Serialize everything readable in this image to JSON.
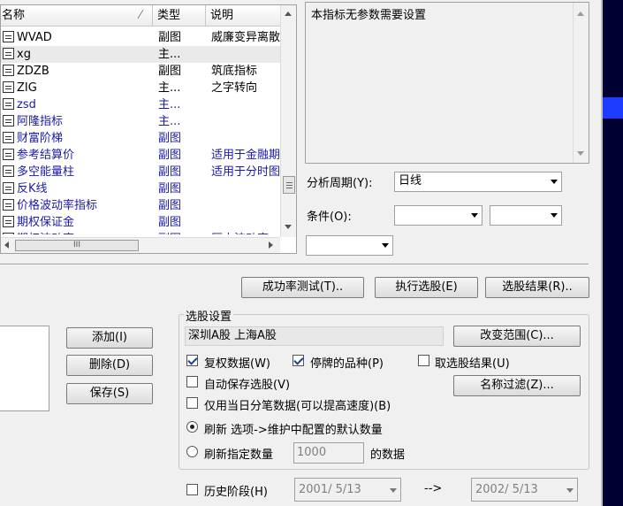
{
  "list": {
    "headers": [
      "名称",
      "类型",
      "说明"
    ],
    "rows": [
      {
        "name": "WVAD",
        "type": "副图",
        "desc": "威廉变异离散",
        "blue": false
      },
      {
        "name": "xg",
        "type": "主...",
        "desc": "",
        "blue": false
      },
      {
        "name": "ZDZB",
        "type": "副图",
        "desc": "筑底指标",
        "blue": false
      },
      {
        "name": "ZIG",
        "type": "主...",
        "desc": "之字转向",
        "blue": false
      },
      {
        "name": "zsd",
        "type": "主...",
        "desc": "",
        "blue": true
      },
      {
        "name": "阿隆指标",
        "type": "主...",
        "desc": "",
        "blue": true
      },
      {
        "name": "财富阶梯",
        "type": "副图",
        "desc": "",
        "blue": true
      },
      {
        "name": "参考结算价",
        "type": "副图",
        "desc": "适用于金融期货",
        "blue": true
      },
      {
        "name": "多空能量柱",
        "type": "副图",
        "desc": "适用于分时图",
        "blue": true
      },
      {
        "name": "反K线",
        "type": "副图",
        "desc": "",
        "blue": true
      },
      {
        "name": "价格波动率指标",
        "type": "副图",
        "desc": "",
        "blue": true
      },
      {
        "name": "期权保证金",
        "type": "副图",
        "desc": "",
        "blue": true
      },
      {
        "name": "期权波动率",
        "type": "副图",
        "desc": "历史波动率",
        "blue": true
      }
    ],
    "hscroll_thumb": "III"
  },
  "param_text": "本指标无参数需要设置",
  "period": {
    "label": "分析周期(Y):",
    "value": "日线"
  },
  "condition": {
    "label": "条件(O):",
    "value1": "",
    "value2": "",
    "value3": ""
  },
  "buttons": {
    "success_test": "成功率测试(T)..",
    "run_select": "执行选股(E)",
    "select_result": "选股结果(R).."
  },
  "side_buttons": {
    "add": "添加(I)",
    "delete": "删除(D)",
    "save": "保存(S)"
  },
  "settings": {
    "group_label": "选股设置",
    "range_text": "深圳A股  上海A股",
    "change_range": "改变范围(C)...",
    "fuquan": "复权数据(W)",
    "tingpai": "停牌的品种(P)",
    "take_result": "取选股结果(U)",
    "name_filter": "名称过滤(Z)...",
    "auto_save": "自动保存选股(V)",
    "today_only": "仅用当日分笔数据(可以提高速度)(B)",
    "refresh_default": "刷新 选项->维护中配置的默认数量",
    "refresh_count": "刷新指定数量",
    "count_value": "1000",
    "count_suffix": "的数据",
    "history": "历史阶段(H)",
    "date_from": "2001/ 5/13",
    "arrow": "-->",
    "date_to": "2002/ 5/13"
  },
  "checkbox_state": {
    "fuquan": true,
    "tingpai": true,
    "take_result": false,
    "auto_save": false,
    "today_only": false,
    "history": false
  },
  "radio_state": {
    "refresh_default": true,
    "refresh_count": false
  },
  "colors": {
    "accent_blue": "#1a1aa6",
    "right_bar": "#000033",
    "highlight": "#1e3cff"
  }
}
